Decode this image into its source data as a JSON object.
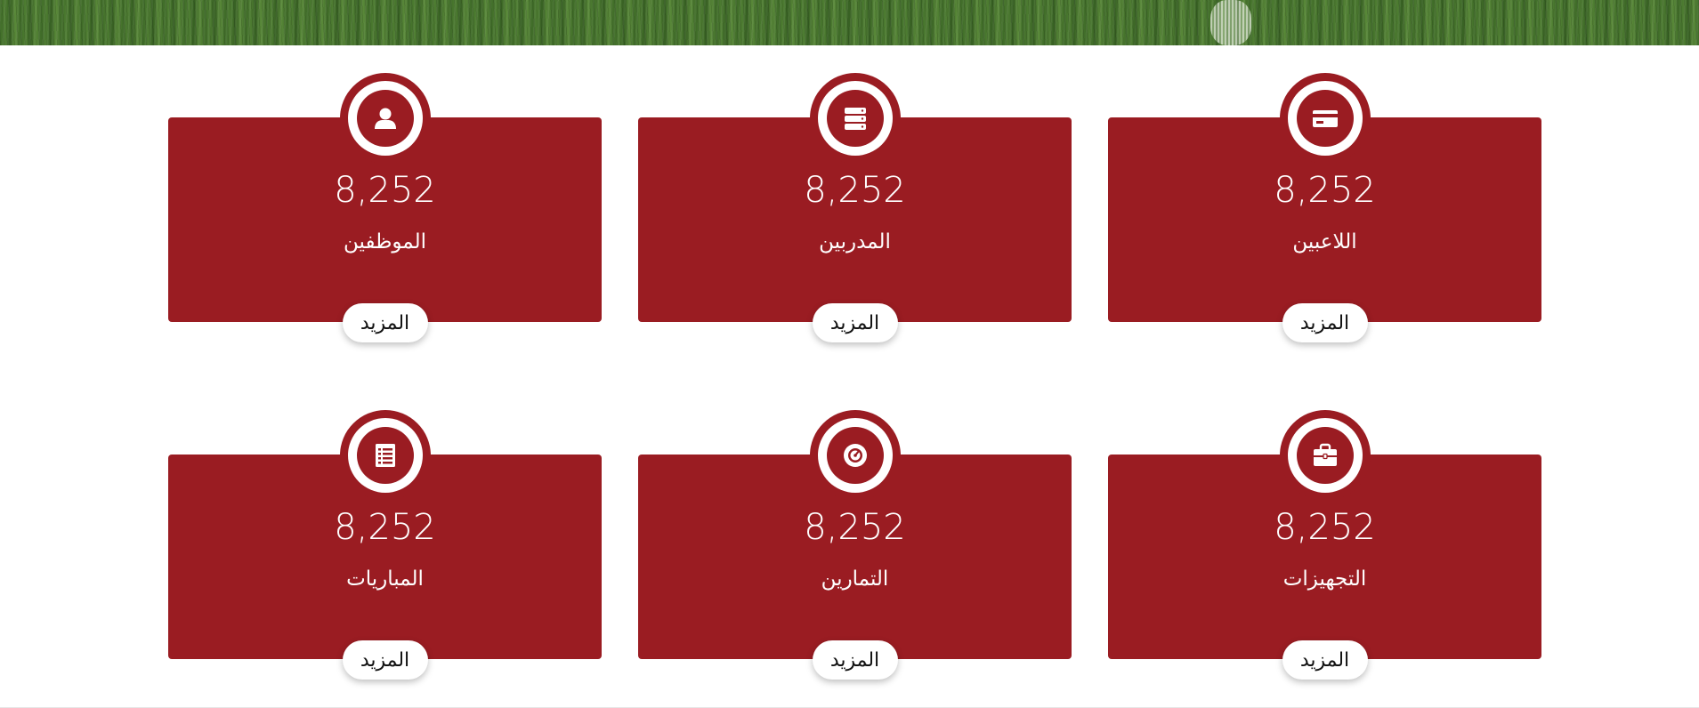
{
  "banner": {
    "image": "football-pitch-grass"
  },
  "colors": {
    "card": "#9a1c22",
    "button_bg": "#ffffff",
    "page_bg": "#ffffff"
  },
  "cards": [
    {
      "value": "8,252",
      "label": "الموظفين",
      "icon": "user-icon",
      "more": "المزيد"
    },
    {
      "value": "8,252",
      "label": "المدربين",
      "icon": "server-icon",
      "more": "المزيد"
    },
    {
      "value": "8,252",
      "label": "اللاعبين",
      "icon": "credit-card-icon",
      "more": "المزيد"
    },
    {
      "value": "8,252",
      "label": "المباريات",
      "icon": "list-icon",
      "more": "المزيد"
    },
    {
      "value": "8,252",
      "label": "التمارين",
      "icon": "dashboard-gauge-icon",
      "more": "المزيد"
    },
    {
      "value": "8,252",
      "label": "التجهيزات",
      "icon": "briefcase-icon",
      "more": "المزيد"
    }
  ]
}
